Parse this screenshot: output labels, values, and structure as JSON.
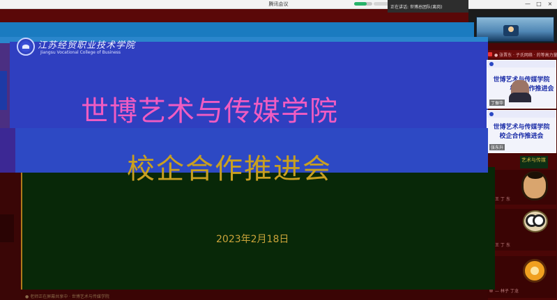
{
  "window": {
    "title": "腾讯会议",
    "speaking_text": "正在讲话: 世博总团队(离岗)",
    "network_quality": 0.7,
    "controls": {
      "minimize": "—",
      "maximize": "□",
      "close": "×"
    }
  },
  "slide": {
    "school_logo_cn": "江苏经贸职业技术学院",
    "school_logo_en": "Jiangsu Vocational College of Business",
    "title_line1": "世博艺术与传媒学院",
    "title_line2": "校企合作推进会",
    "date": "2023年2月18日",
    "bottom_caption": "● 老师正在屏幕共享中 · 世博艺术与传媒学院"
  },
  "participants": {
    "top_bar_text": "● 张晋东 · 子氏网络 · 的等高力量",
    "tiles": [
      {
        "slide_title_1": "世博艺术与传媒学院",
        "slide_title_2": "校企合作推进会",
        "name": "丁振华"
      },
      {
        "slide_title_1": "世博艺术与传媒学院",
        "slide_title_2": "校企合作推进会",
        "name": "张东升"
      }
    ],
    "list": [
      {
        "label": "艺术与传媒"
      },
      {
        "label": "王 丁 东"
      },
      {
        "label": "王 丁 东"
      },
      {
        "label": "— 林子 丁龙"
      }
    ]
  }
}
